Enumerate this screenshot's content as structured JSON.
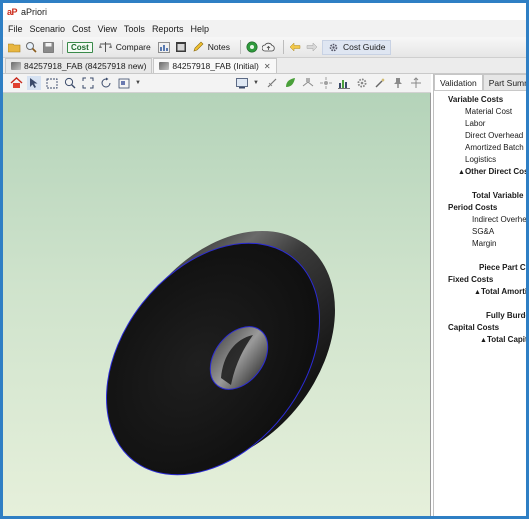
{
  "window": {
    "logo_text": "aP",
    "title": "aPriori"
  },
  "menu": [
    "File",
    "Scenario",
    "Cost",
    "View",
    "Tools",
    "Reports",
    "Help"
  ],
  "toolbar": {
    "cost_label": "Cost",
    "compare_label": "Compare",
    "notes_label": "Notes",
    "cost_guide_label": "Cost Guide"
  },
  "tabs": [
    {
      "label": "84257918_FAB (84257918 new)",
      "active": false
    },
    {
      "label": "84257918_FAB (Initial)",
      "active": true
    }
  ],
  "panel": {
    "tabs": [
      "Validation",
      "Part Summ"
    ],
    "tree": [
      {
        "label": "Variable Costs",
        "indent": 0,
        "bold": true
      },
      {
        "label": "Material Cost",
        "indent": 2,
        "bold": false
      },
      {
        "label": "Labor",
        "indent": 2,
        "bold": false
      },
      {
        "label": "Direct Overhead",
        "indent": 2,
        "bold": false
      },
      {
        "label": "Amortized Batch S",
        "indent": 2,
        "bold": false
      },
      {
        "label": "Logistics",
        "indent": 2,
        "bold": false
      },
      {
        "label": "Other Direct Cos",
        "indent": 1,
        "bold": true,
        "prefix": "+"
      },
      {
        "label": "",
        "indent": 0,
        "bold": false
      },
      {
        "label": "Total Variable C",
        "indent": 3,
        "bold": true
      },
      {
        "label": "Period Costs",
        "indent": 0,
        "bold": true
      },
      {
        "label": "Indirect Overhea",
        "indent": 3,
        "bold": false
      },
      {
        "label": "SG&A",
        "indent": 3,
        "bold": false
      },
      {
        "label": "Margin",
        "indent": 3,
        "bold": false
      },
      {
        "label": "",
        "indent": 0,
        "bold": false
      },
      {
        "label": "Piece Part Co",
        "indent": 4,
        "bold": true
      },
      {
        "label": "Fixed Costs",
        "indent": 0,
        "bold": true
      },
      {
        "label": "Total Amorti",
        "indent": 3,
        "bold": true,
        "prefix": "+"
      },
      {
        "label": "",
        "indent": 0,
        "bold": false
      },
      {
        "label": "Fully Burde",
        "indent": 5,
        "bold": true
      },
      {
        "label": "Capital Costs",
        "indent": 0,
        "bold": true
      },
      {
        "label": "Total Capita",
        "indent": 4,
        "bold": true,
        "prefix": "+"
      }
    ]
  },
  "colors": {
    "accent": "#2f7fc4",
    "viewport_top": "#b4d3b9",
    "viewport_bottom": "#e6f0db",
    "part_face": "#1c1c1c",
    "part_edge": "#2b2bd6"
  }
}
